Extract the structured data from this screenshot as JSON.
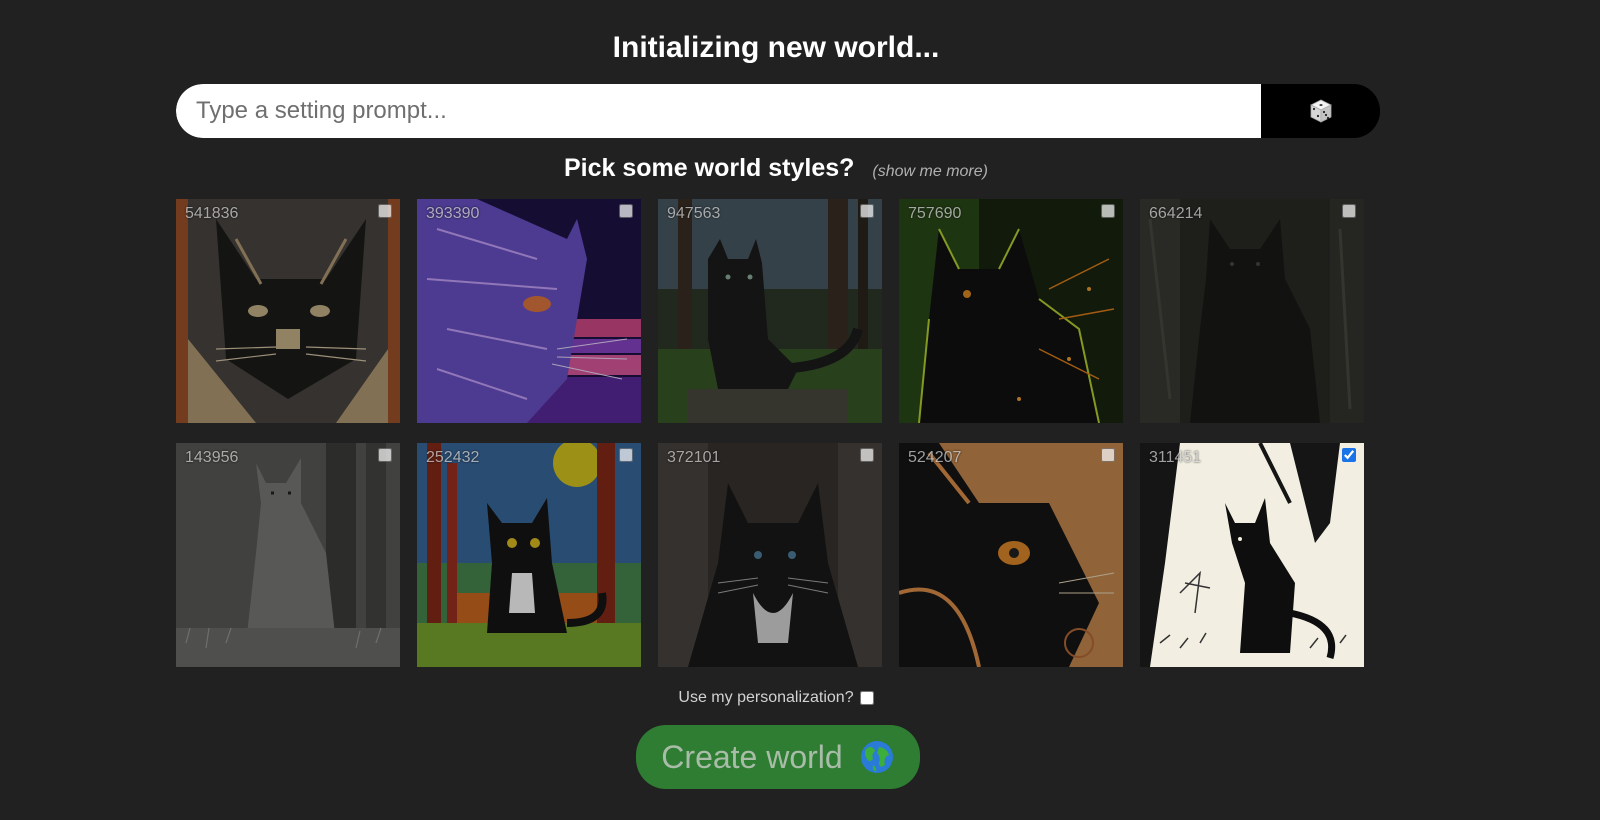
{
  "header": {
    "title": "Initializing new world..."
  },
  "prompt": {
    "placeholder": "Type a setting prompt...",
    "dice_icon": "dice-icon"
  },
  "styles": {
    "heading": "Pick some world styles?",
    "more_link": "(show me more)",
    "items": [
      {
        "id": "541836",
        "checked": false,
        "icon": "cat-portrait-image"
      },
      {
        "id": "393390",
        "checked": false,
        "icon": "cat-purple-sunset-image"
      },
      {
        "id": "947563",
        "checked": false,
        "icon": "cat-forest-image"
      },
      {
        "id": "757690",
        "checked": false,
        "icon": "cat-glowing-image"
      },
      {
        "id": "664214",
        "checked": false,
        "icon": "cat-dark-forest-image"
      },
      {
        "id": "143956",
        "checked": false,
        "icon": "cat-sketch-image"
      },
      {
        "id": "252432",
        "checked": false,
        "icon": "cat-cartoon-image"
      },
      {
        "id": "372101",
        "checked": false,
        "icon": "cat-fluffy-image"
      },
      {
        "id": "524207",
        "checked": false,
        "icon": "cat-orange-profile-image"
      },
      {
        "id": "311451",
        "checked": true,
        "icon": "cat-ink-drawing-image"
      }
    ]
  },
  "personalization": {
    "label": "Use my personalization?",
    "checked": false
  },
  "create": {
    "label": "Create world",
    "icon": "globe-icon"
  },
  "colors": {
    "background": "#212121",
    "create_button": "#2e7d32",
    "checkbox_accent": "#1a73e8"
  }
}
